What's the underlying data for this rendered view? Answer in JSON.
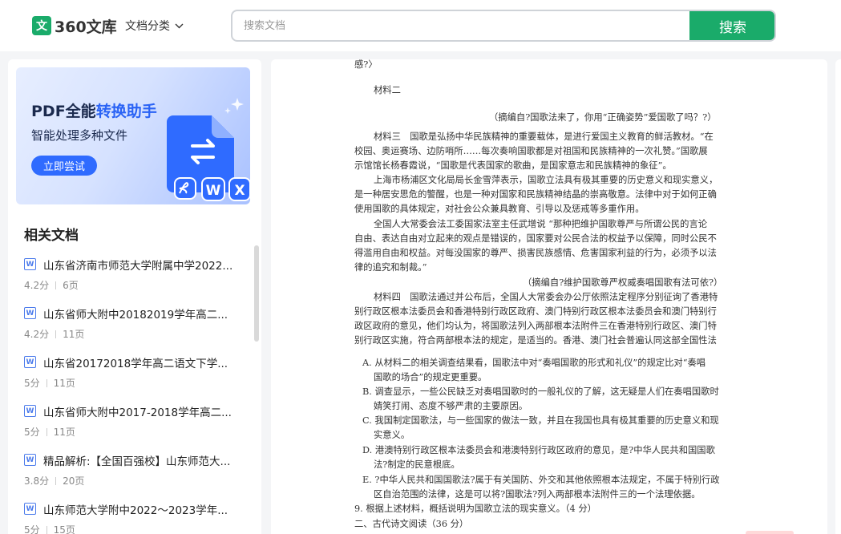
{
  "header": {
    "logo_mark": "文",
    "logo_text": "360文库",
    "category_label": "文档分类",
    "search_placeholder": "搜索文档",
    "search_button": "搜索",
    "accent_color": "#1aab6a"
  },
  "promo": {
    "title_prefix": "PDF全能",
    "title_highlight": "转换助手",
    "subtitle": "智能处理多种文件",
    "button": "立即尝试",
    "icons": [
      "pdf-icon",
      "word-icon",
      "excel-icon",
      "convert-icon"
    ]
  },
  "related": {
    "title": "相关文档",
    "items": [
      {
        "title": "山东省济南市师范大学附属中学2022...",
        "score": "4.2分",
        "pages": "6页"
      },
      {
        "title": "山东省师大附中20182019学年高二...",
        "score": "4.2分",
        "pages": "11页"
      },
      {
        "title": "山东省20172018学年高二语文下学...",
        "score": "5分",
        "pages": "11页"
      },
      {
        "title": "山东省师大附中2017-2018学年高二...",
        "score": "5分",
        "pages": "11页"
      },
      {
        "title": "精品解析:【全国百强校】山东师范大...",
        "score": "3.8分",
        "pages": "20页"
      },
      {
        "title": "山东师范大学附中2022～2023学年...",
        "score": "5分",
        "pages": "15页"
      }
    ]
  },
  "document": {
    "lines": [
      "感?〉",
      "材料二",
      "（摘编自?国歌法来了，你用“正确姿势”爱国歌了吗？?）",
      "材料三　国歌是弘扬中华民族精神的重要载体，是进行爱国主义教育的鲜活教材。“在",
      "校园、奥运赛场、边防哨所……每次奏响国歌都是对祖国和民族精神的一次礼赞。”国歌展",
      "示馆馆长杨春霞说，“国歌是代表国家的歌曲，是国家意志和民族精神的象征”。",
      "上海市杨浦区文化局局长金雪萍表示，国歌立法具有极其重要的历史意义和现实意义，",
      "是一种居安思危的警醒，也是一种对国家和民族精神结晶的崇高敬意。法律中对于如何正确",
      "使用国歌的具体规定，对社会公众兼具教育、引导以及惩戒等多重作用。",
      "全国人大常委会法工委国家法室主任武增说 “那种把维护国歌尊严与所谓公民的言论",
      "自由、表达自由对立起来的观点是错误的，国家要对公民合法的权益予以保障，同时公民不",
      "得滥用自由和权益。对每没国家的尊严、损害民族感情、危害国家利益的行为，必须予以法",
      "律的追究和制裁。”",
      "（摘编自?维护国歌尊严权威奏唱国歌有法可依?）",
      "材料四　国歌法通过并公布后，全国人大常委会办公厅依照法定程序分别征询了香港特",
      "别行政区根本法委员会和香港特别行政区政府、澳门特别行政区根本法委员会和澳门特别行",
      "政区政府的意见，他们均认为，将国歌法列入两部根本法附件三在香港特别行政区、澳门特",
      "别行政区实施，符合两部根本法的规定，是适当的。香港、澳门社会普遍认同这部全国性法",
      "A. 从材料二的相关调查结果看，国歌法中对“奏唱国歌的形式和礼仪”的规定比对“奏唱",
      "国歌的场合”的规定更重要。",
      "B. 调查显示，一些公民缺乏对奏唱国歌时的一般礼仪的了解，这无疑是人们在奏唱国歌时",
      "婧笑打闹、态度不够严肃的主要原因。",
      "C. 我国制定国歌法，与一些国家的做法一致，并且在我国也具有极其重要的历史意义和现",
      "实意义。",
      "D. 港澳特别行政区根本法委员会和港澳特别行政区政府的意见，是?中华人民共和国国歌",
      "法?制定的民意根底。",
      "E. ?中华人民共和国国歌法?属于有关国防、外交和其他依照根本法规定，不属于特别行政",
      "区自治范围的法律，这是可以将?国歌法?列入两部根本法附件三的一个法理依据。",
      "9. 根据上述材料，概括说明为国歌立法的现实意义。（4 分）",
      "二、古代诗文阅读（36 分）"
    ]
  }
}
